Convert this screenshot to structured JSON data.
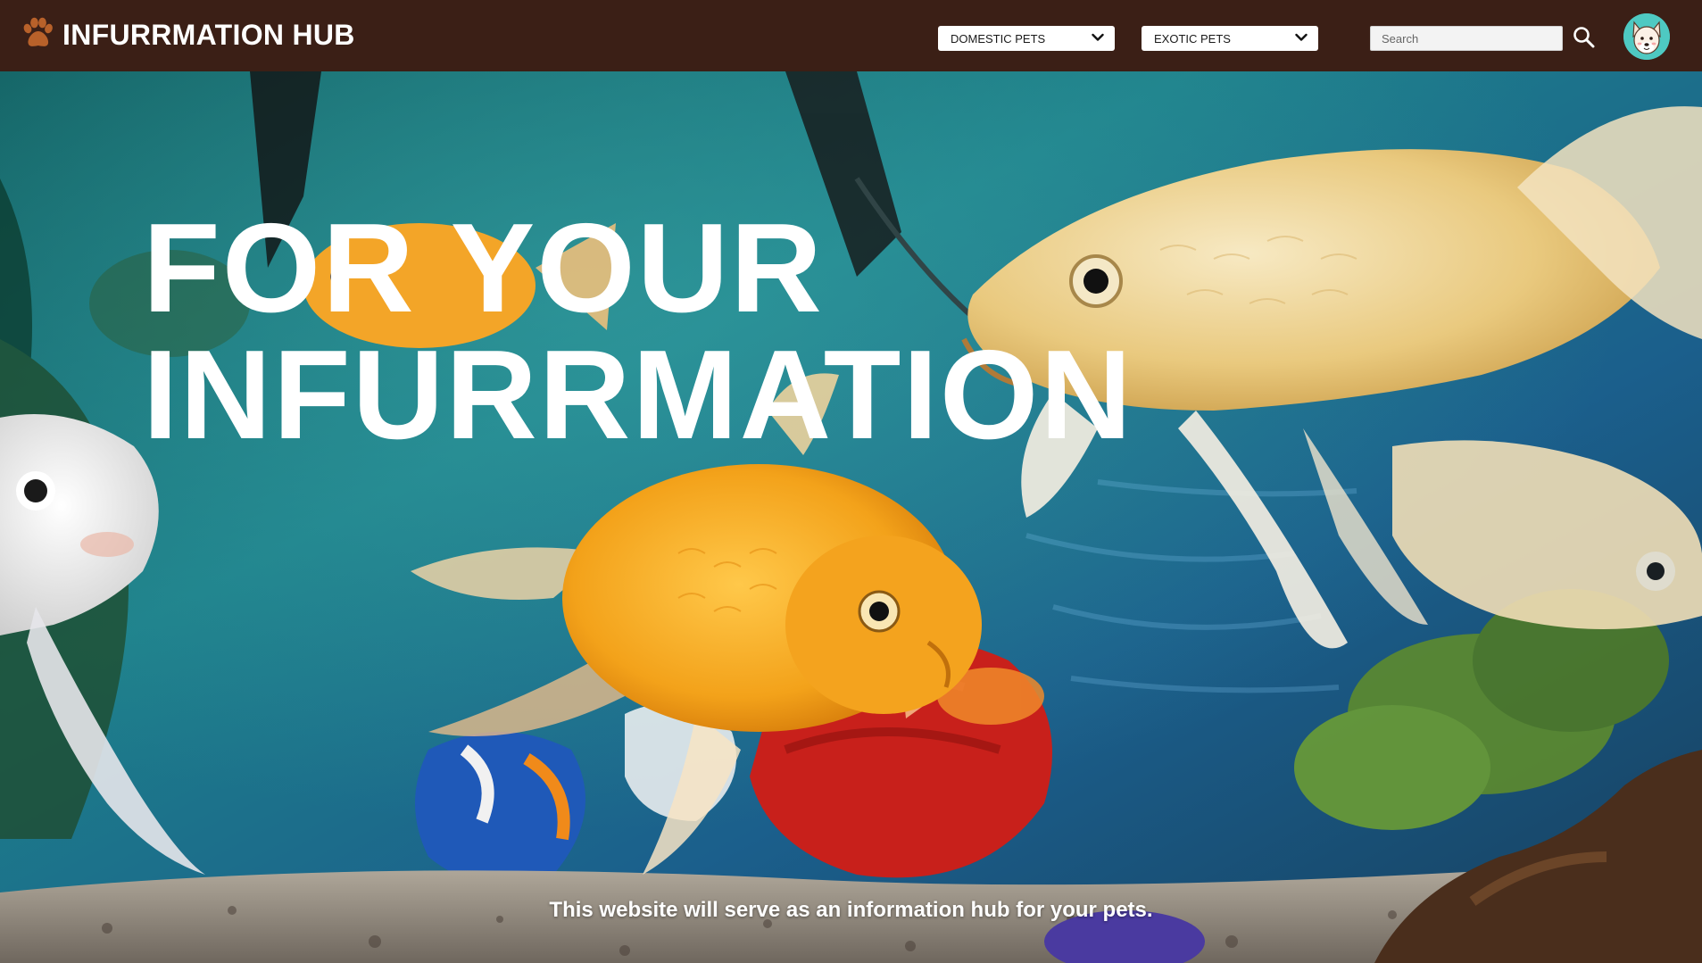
{
  "header": {
    "brand_title": "INFURRMATION HUB",
    "logo_icon": "paw-icon",
    "dropdowns": [
      {
        "label": "DOMESTIC PETS",
        "icon": "chevron-down-icon"
      },
      {
        "label": "EXOTIC PETS",
        "icon": "chevron-down-icon"
      }
    ],
    "search": {
      "placeholder": "Search",
      "value": "",
      "icon": "search-icon"
    },
    "avatar_icon": "dog-avatar-icon"
  },
  "hero": {
    "heading_line1": "FOR YOUR",
    "heading_line2": "INFURRMATION",
    "caption": "This website will serve as an information hub for your pets.",
    "background": "aquarium-goldfish-photo"
  },
  "colors": {
    "header_bg": "#3b1f16",
    "logo_paw": "#b8612a",
    "text_light": "#ffffff",
    "avatar_bg": "#4ec9c2"
  }
}
